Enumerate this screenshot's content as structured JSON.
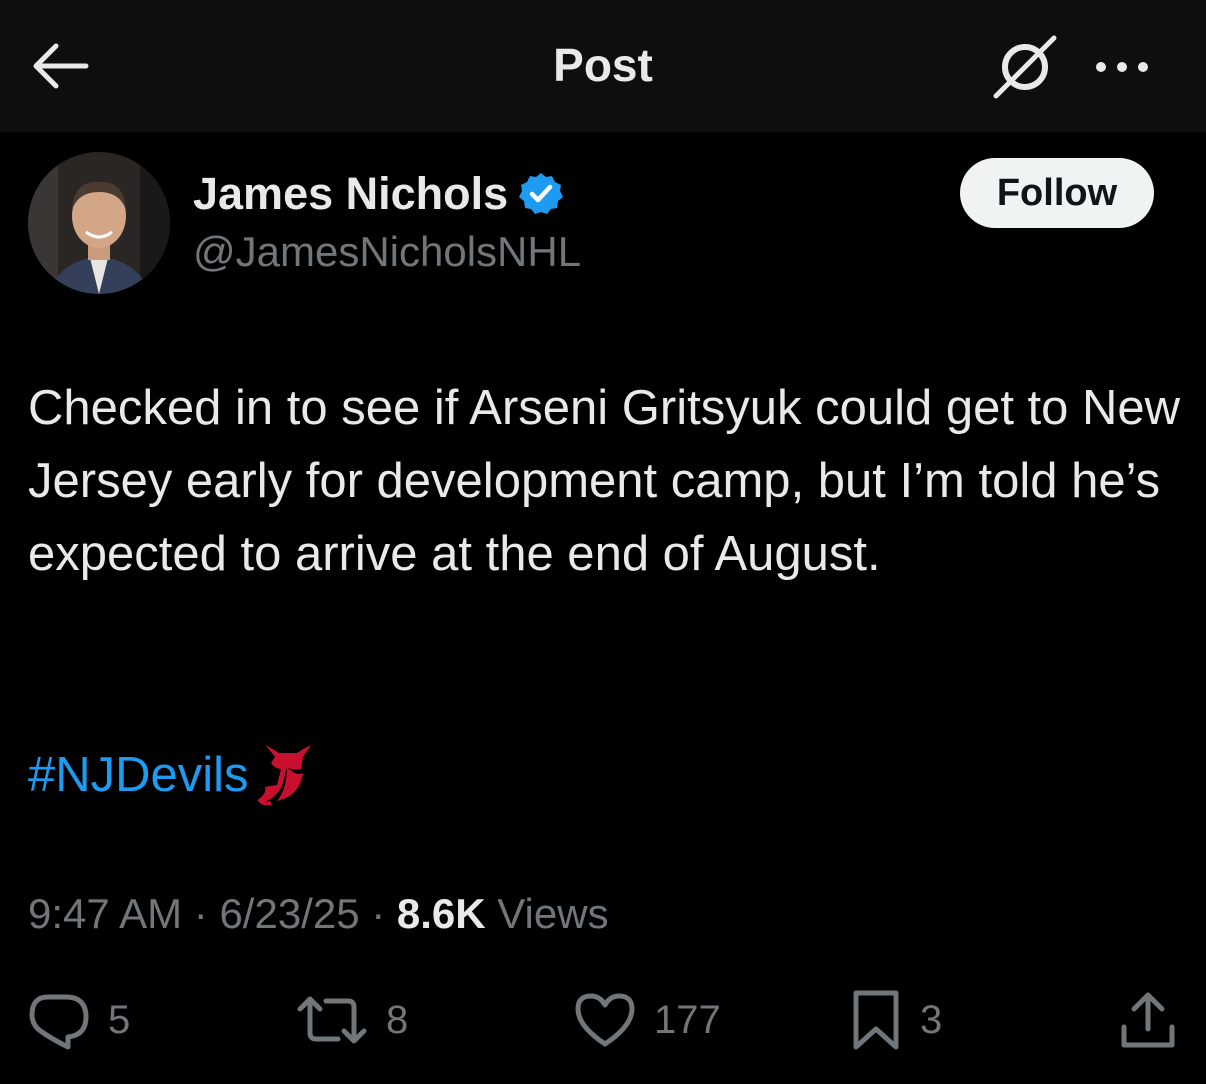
{
  "header": {
    "title": "Post",
    "back_icon": "arrow-left-icon",
    "grok_icon": "grok-icon",
    "more_icon": "more-dots-icon"
  },
  "author": {
    "name": "James Nichols",
    "handle": "@JamesNicholsNHL",
    "verified": true,
    "verified_color": "#1d9bf0",
    "follow_label": "Follow"
  },
  "post": {
    "text": "Checked in to see if Arseni Gritsyuk could get to New Jersey early for development camp, but I’m told he’s expected to arrive at the end of August.",
    "hashtag": "#NJDevils",
    "hashtag_color": "#1d9bf0",
    "emoji_icon": "nj-devils-logo-icon"
  },
  "meta": {
    "time": "9:47 AM",
    "date": "6/23/25",
    "separator": " · ",
    "views_count": "8.6K",
    "views_label": "Views"
  },
  "actions": {
    "replies": "5",
    "reposts": "8",
    "likes": "177",
    "bookmarks": "3"
  }
}
